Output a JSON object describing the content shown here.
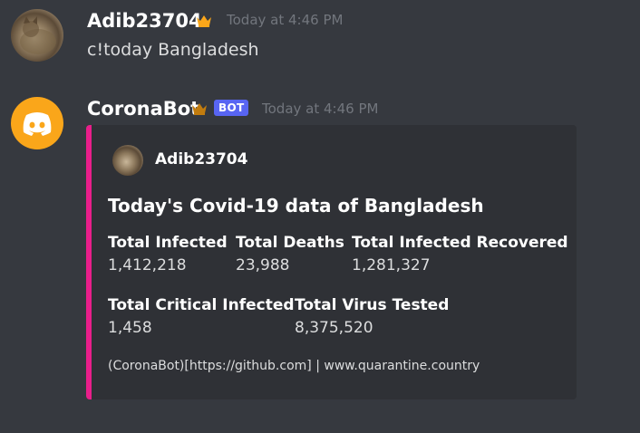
{
  "messages": [
    {
      "username": "Adib23704",
      "timestamp": "Today at 4:46 PM",
      "content": "c!today Bangladesh",
      "avatar_icon": "cat-avatar",
      "crown_color": "#faa61a"
    },
    {
      "username": "CoronaBot",
      "timestamp": "Today at 4:46 PM",
      "badge": "BOT",
      "avatar_icon": "discord-logo-icon",
      "crown_color": "#c27c0e"
    }
  ],
  "embed": {
    "accent_color": "#e91e8a",
    "author": "Adib23704",
    "title": "Today's Covid-19 data of Bangladesh",
    "fields": [
      {
        "name": "Total Infected",
        "value": "1,412,218"
      },
      {
        "name": "Total Deaths",
        "value": "23,988"
      },
      {
        "name": "Total Infected Recovered",
        "value": "1,281,327"
      },
      {
        "name": "Total Critical Infected",
        "value": "1,458"
      },
      {
        "name": "Total Virus Tested",
        "value": "8,375,520"
      }
    ],
    "footer": "(CoronaBot)[https://github.com] | www.quarantine.country"
  }
}
